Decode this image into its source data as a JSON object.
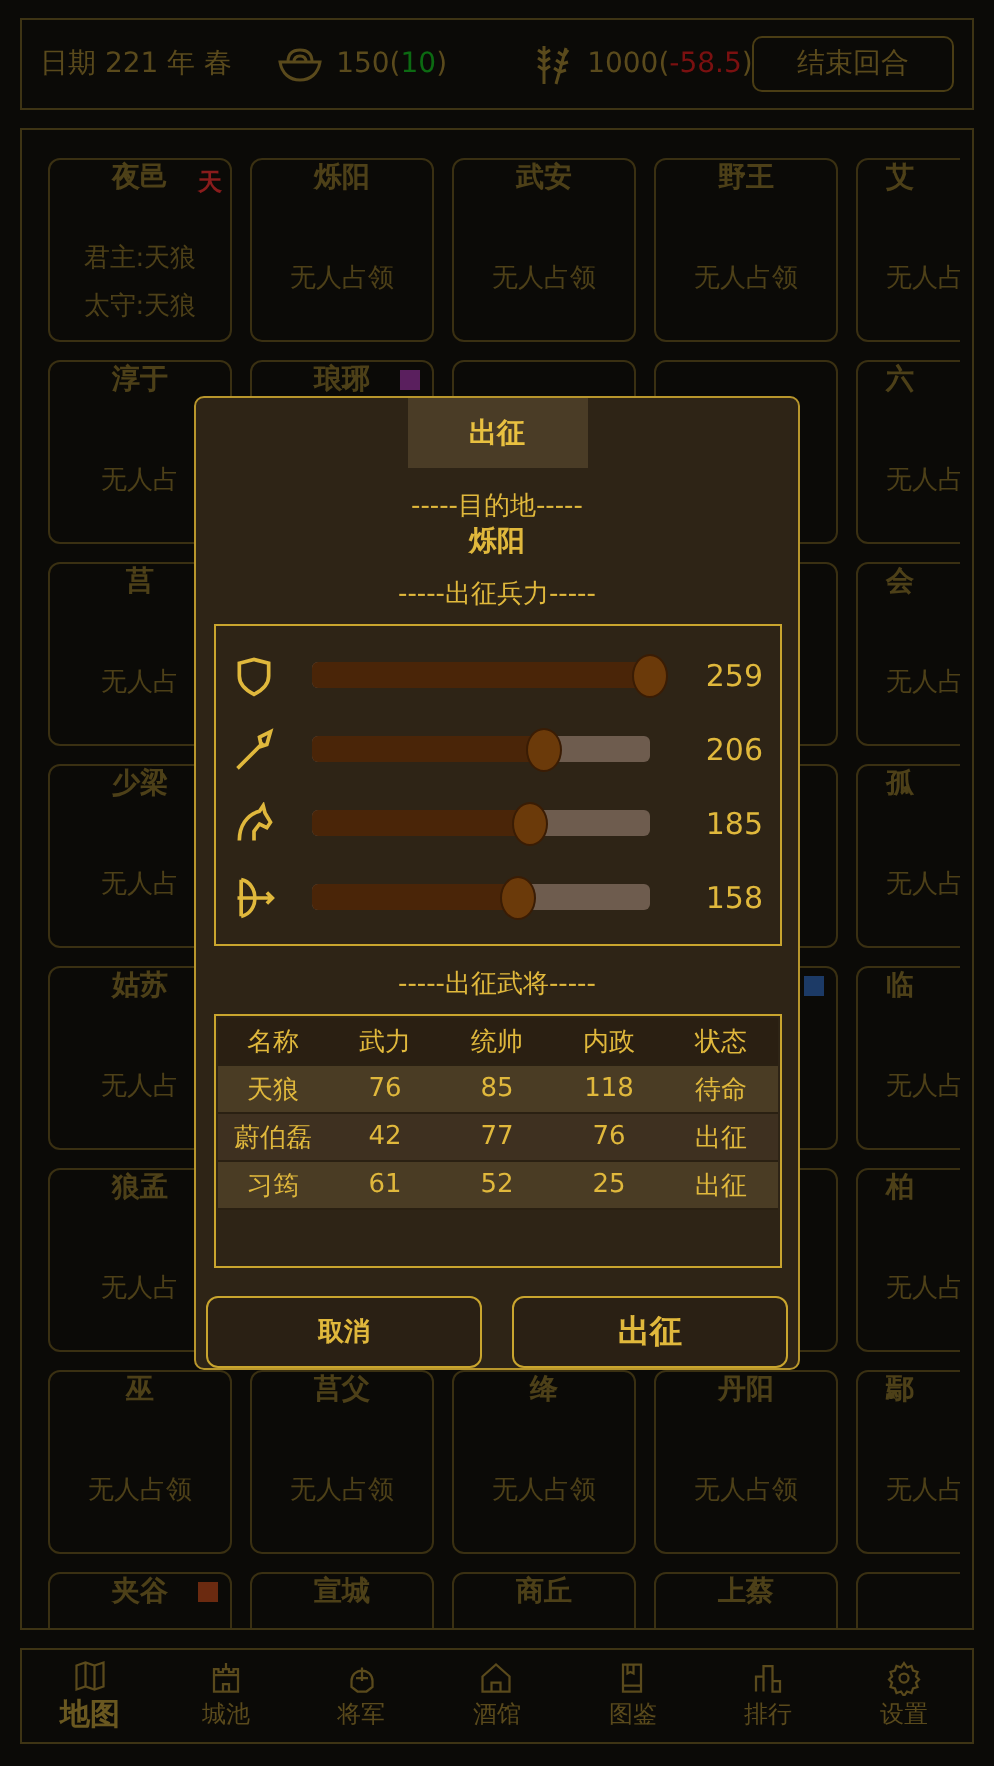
{
  "top_bar": {
    "date": "日期  221 年 春",
    "silver": {
      "amount": "150(",
      "delta": "10",
      "close": ")"
    },
    "grain": {
      "amount": "1000(",
      "delta": "-58.5",
      "close": ")"
    },
    "end_turn": "结束回合"
  },
  "map_rows": [
    [
      {
        "kind": "city",
        "title": "夜邑",
        "badge": {
          "text": "天",
          "color": "#8a1c1c"
        },
        "lines": [
          "君主:天狼",
          "太守:天狼"
        ]
      },
      {
        "kind": "city",
        "title": "烁阳",
        "lines": [
          "无人占领"
        ]
      },
      {
        "kind": "city",
        "title": "武安",
        "lines": [
          "无人占领"
        ]
      },
      {
        "kind": "city",
        "title": "野王",
        "lines": [
          "无人占领"
        ]
      },
      {
        "kind": "city",
        "title": "艾",
        "lines": [
          "无人占"
        ]
      }
    ],
    [
      {
        "kind": "city",
        "title": "淳于",
        "lines": [
          "无人占"
        ]
      },
      {
        "kind": "city",
        "title": "琅琊",
        "badge": {
          "color": "#5a1f5e"
        }
      },
      {
        "kind": "covered"
      },
      {
        "kind": "covered"
      },
      {
        "kind": "city",
        "title": "六",
        "lines": [
          "无人占"
        ]
      }
    ],
    [
      {
        "kind": "city",
        "title": "莒",
        "lines": [
          "无人占"
        ]
      },
      {
        "kind": "hidden"
      },
      {
        "kind": "hidden"
      },
      {
        "kind": "covered"
      },
      {
        "kind": "city",
        "title": "会",
        "lines": [
          "无人占"
        ]
      }
    ],
    [
      {
        "kind": "city",
        "title": "少梁",
        "lines": [
          "无人占"
        ]
      },
      {
        "kind": "hidden"
      },
      {
        "kind": "hidden"
      },
      {
        "kind": "covered"
      },
      {
        "kind": "city",
        "title": "孤",
        "lines": [
          "无人占"
        ]
      }
    ],
    [
      {
        "kind": "city",
        "title": "姑苏",
        "lines": [
          "无人占"
        ]
      },
      {
        "kind": "hidden"
      },
      {
        "kind": "hidden"
      },
      {
        "kind": "covered",
        "badge": {
          "color": "#1c3a66"
        }
      },
      {
        "kind": "city",
        "title": "临",
        "lines": [
          "无人占"
        ]
      }
    ],
    [
      {
        "kind": "city",
        "title": "狼孟",
        "lines": [
          "无人占"
        ]
      },
      {
        "kind": "hidden"
      },
      {
        "kind": "hidden"
      },
      {
        "kind": "covered"
      },
      {
        "kind": "city",
        "title": "柏",
        "lines": [
          "无人占"
        ]
      }
    ],
    [
      {
        "kind": "city",
        "title": "巫",
        "lines": [
          "无人占领"
        ]
      },
      {
        "kind": "city",
        "title": "莒父",
        "lines": [
          "无人占领"
        ]
      },
      {
        "kind": "city",
        "title": "绛",
        "lines": [
          "无人占领"
        ]
      },
      {
        "kind": "city",
        "title": "丹阳",
        "lines": [
          "无人占领"
        ]
      },
      {
        "kind": "city",
        "title": "鄢",
        "lines": [
          "无人占"
        ]
      }
    ],
    [
      {
        "kind": "city",
        "title": "夹谷",
        "badge": {
          "color": "#6b2a10"
        }
      },
      {
        "kind": "city",
        "title": "宣城"
      },
      {
        "kind": "city",
        "title": "商丘"
      },
      {
        "kind": "city",
        "title": "上蔡"
      },
      {
        "kind": "covered"
      }
    ]
  ],
  "dialog": {
    "tab": "出征",
    "destination_heading": "-----目的地-----",
    "destination": "烁阳",
    "troops_heading": "-----出征兵力-----",
    "troops": [
      {
        "kind": "shield",
        "level": 1.0,
        "reading": "259"
      },
      {
        "kind": "spear",
        "level": 0.69,
        "reading": "206"
      },
      {
        "kind": "horse",
        "level": 0.65,
        "reading": "185"
      },
      {
        "kind": "bow",
        "level": 0.61,
        "reading": "158"
      }
    ],
    "generals_heading": "-----出征武将-----",
    "table": {
      "columns": [
        "名称",
        "武力",
        "统帅",
        "内政",
        "状态"
      ],
      "rows": [
        [
          "天狼",
          "76",
          "85",
          "118",
          "待命"
        ],
        [
          "蔚伯磊",
          "42",
          "77",
          "76",
          "出征"
        ],
        [
          "习筠",
          "61",
          "52",
          "25",
          "出征"
        ]
      ]
    },
    "buttons": [
      "取消",
      "出征"
    ]
  },
  "nav": [
    {
      "kind": "map",
      "label": "地图",
      "selected": true
    },
    {
      "kind": "castle",
      "label": "城池",
      "selected": false
    },
    {
      "kind": "helmet",
      "label": "将军",
      "selected": false
    },
    {
      "kind": "house",
      "label": "酒馆",
      "selected": false
    },
    {
      "kind": "book",
      "label": "图鉴",
      "selected": false
    },
    {
      "kind": "chart",
      "label": "排行",
      "selected": false
    },
    {
      "kind": "gear",
      "label": "设置",
      "selected": false
    }
  ]
}
